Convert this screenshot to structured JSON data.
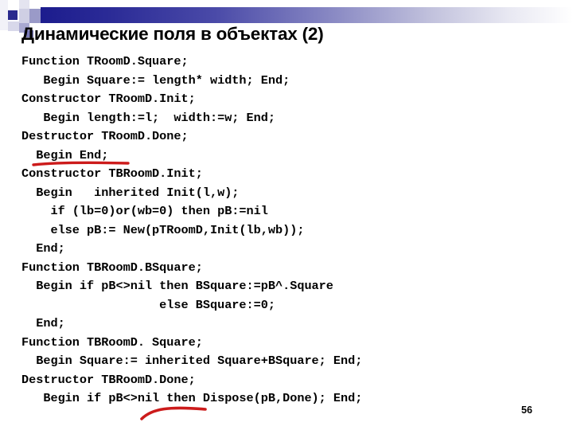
{
  "slide": {
    "title": "Динамические поля в объектах (2)",
    "number": "56",
    "code_lines": [
      "Function TRoomD.Square;",
      "   Begin Square:= length* width; End;",
      "Constructor TRoomD.Init;",
      "   Begin length:=l;  width:=w; End;",
      "Destructor TRoomD.Done;",
      "  Begin End;",
      "Constructor TBRoomD.Init;",
      "  Begin   inherited Init(l,w);",
      "    if (lb=0)or(wb=0) then pB:=nil",
      "    else pB:= New(pTRoomD,Init(lb,wb));",
      "  End;",
      "Function TBRoomD.BSquare;",
      "  Begin if pB<>nil then BSquare:=pB^.Square",
      "                   else BSquare:=0;",
      "  End;",
      "Function TBRoomD. Square;",
      "  Begin Square:= inherited Square+BSquare; End;",
      "Destructor TBRoomD.Done;",
      "   Begin if pB<>nil then Dispose(pB,Done); End;"
    ],
    "annotations": [
      {
        "name": "red-underline",
        "target": "Begin End;"
      },
      {
        "name": "red-curve",
        "target": "pB<>nil"
      }
    ],
    "colors": {
      "banner_start": "#1a1a8c",
      "banner_end": "#ffffff",
      "annotation_red": "#cc1b1b",
      "text": "#000000",
      "background": "#ffffff"
    }
  }
}
